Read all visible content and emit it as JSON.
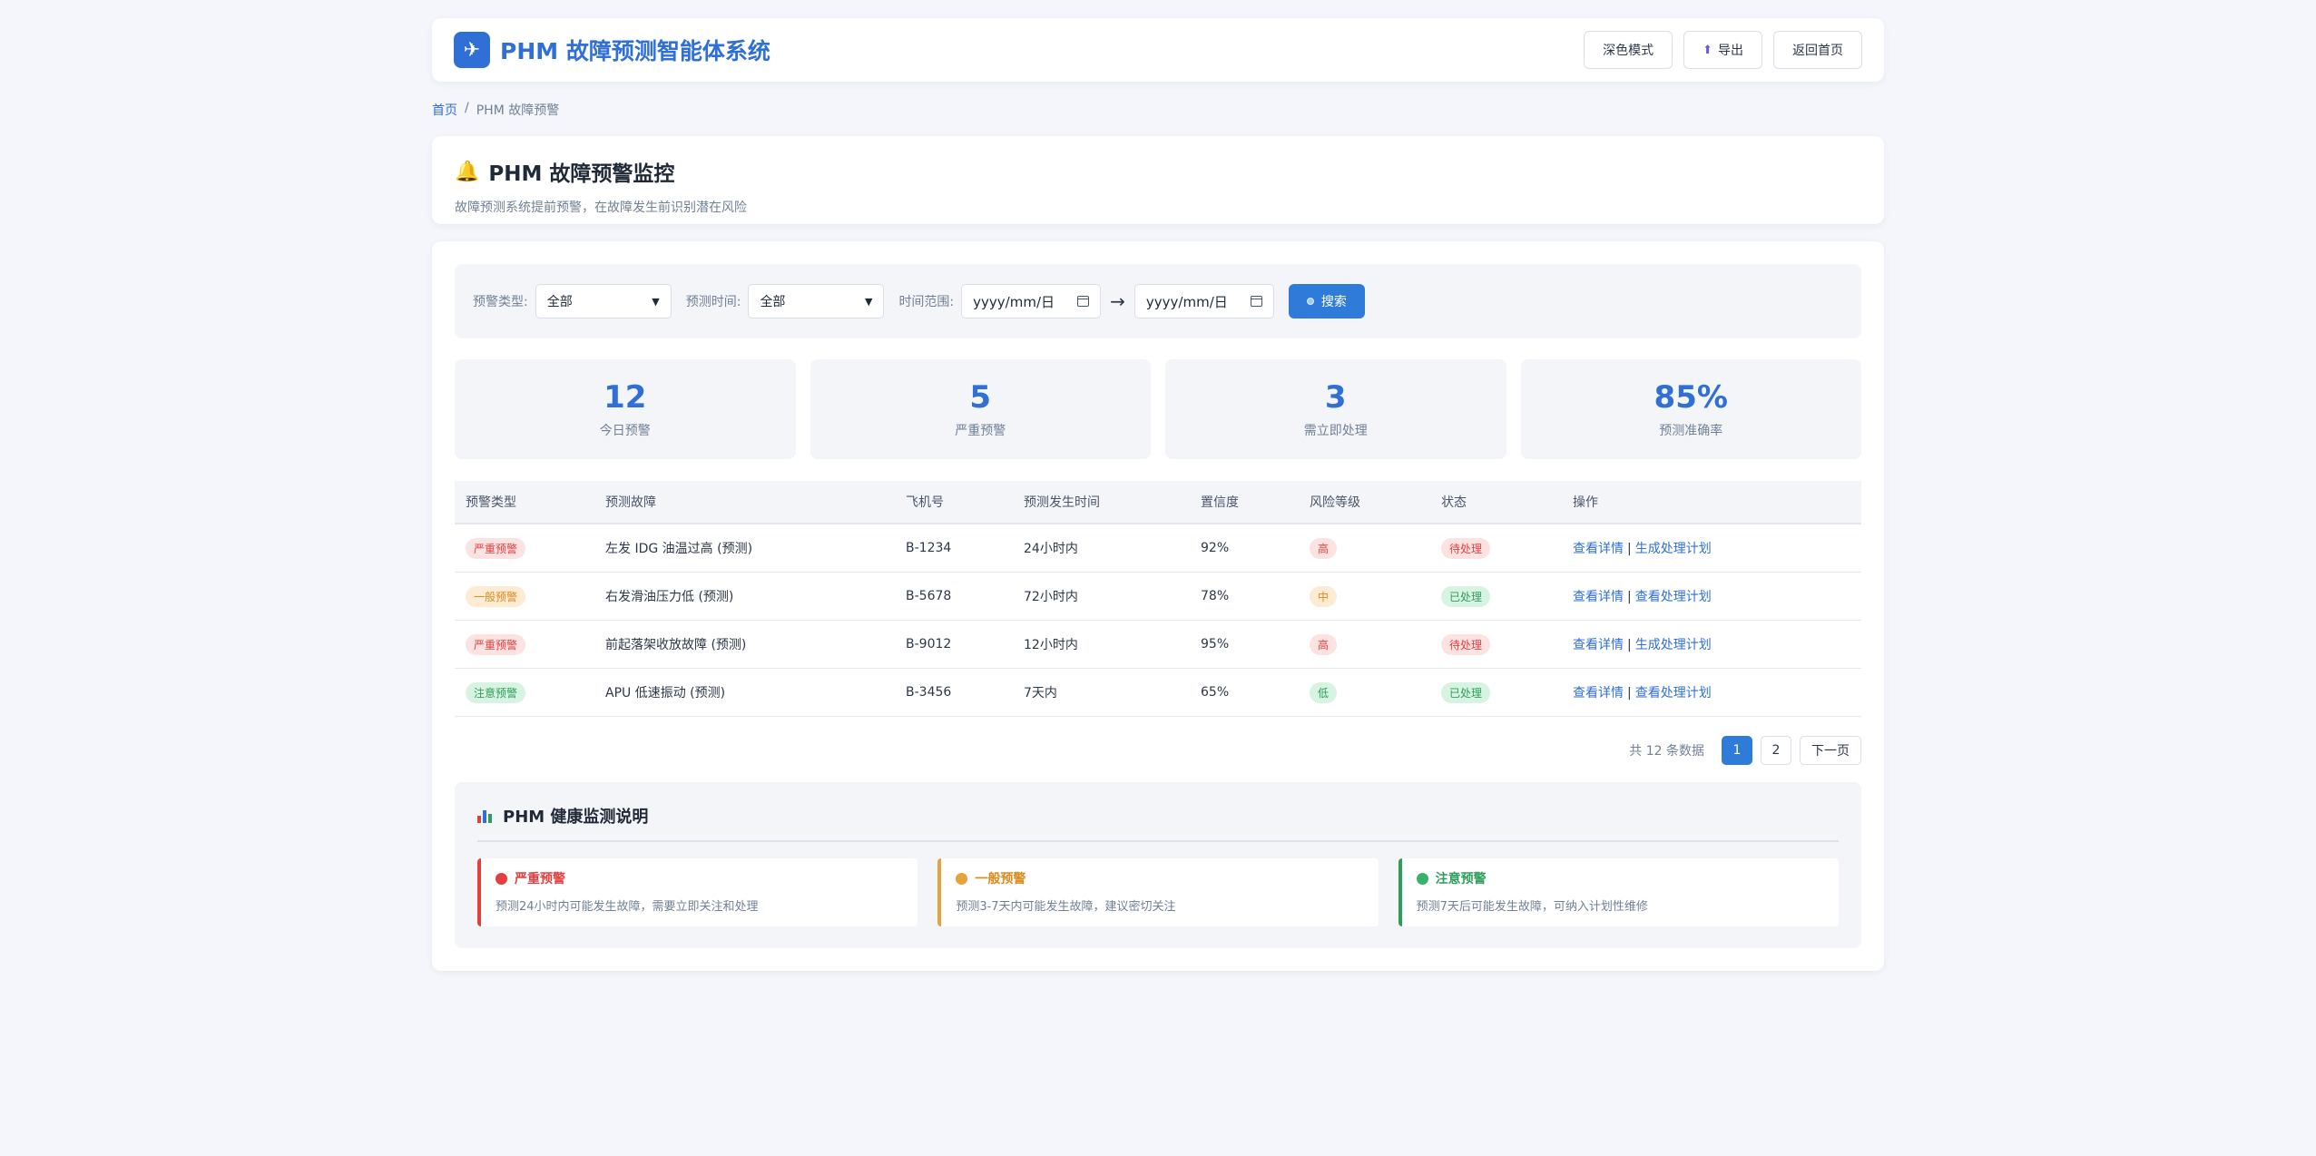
{
  "header": {
    "title": "PHM 故障预测智能体系统",
    "logo_icon": "plane-icon",
    "buttons": {
      "dark_mode": "深色模式",
      "export": "导出",
      "home": "返回首页"
    }
  },
  "breadcrumb": {
    "home": "首页",
    "separator": "/",
    "current": "PHM 故障预警"
  },
  "page": {
    "title": "PHM 故障预警监控",
    "subtitle": "故障预测系统提前预警，在故障发生前识别潜在风险"
  },
  "filters": {
    "type_label": "预警类型:",
    "type_value": "全部",
    "time_label": "预测时间:",
    "time_value": "全部",
    "range_label": "时间范围:",
    "date_start_placeholder": "yyyy/mm/日",
    "date_end_placeholder": "yyyy/mm/日",
    "range_arrow": "→",
    "search_label": "搜索"
  },
  "stats": [
    {
      "value": "12",
      "label": "今日预警"
    },
    {
      "value": "5",
      "label": "严重预警"
    },
    {
      "value": "3",
      "label": "需立即处理"
    },
    {
      "value": "85%",
      "label": "预测准确率"
    }
  ],
  "table": {
    "headers": [
      "预警类型",
      "预测故障",
      "飞机号",
      "预测发生时间",
      "置信度",
      "风险等级",
      "状态",
      "操作"
    ],
    "rows": [
      {
        "type": "严重预警",
        "type_color": "red",
        "fault": "左发 IDG 油温过高 (预测)",
        "aircraft": "B-1234",
        "time": "24小时内",
        "confidence": "92%",
        "risk": "高",
        "risk_color": "red",
        "status": "待处理",
        "status_color": "red",
        "action1": "查看详情",
        "action2": "生成处理计划"
      },
      {
        "type": "一般预警",
        "type_color": "orange",
        "fault": "右发滑油压力低 (预测)",
        "aircraft": "B-5678",
        "time": "72小时内",
        "confidence": "78%",
        "risk": "中",
        "risk_color": "orange",
        "status": "已处理",
        "status_color": "green",
        "action1": "查看详情",
        "action2": "查看处理计划"
      },
      {
        "type": "严重预警",
        "type_color": "red",
        "fault": "前起落架收放故障 (预测)",
        "aircraft": "B-9012",
        "time": "12小时内",
        "confidence": "95%",
        "risk": "高",
        "risk_color": "red",
        "status": "待处理",
        "status_color": "red",
        "action1": "查看详情",
        "action2": "生成处理计划"
      },
      {
        "type": "注意预警",
        "type_color": "green",
        "fault": "APU 低速振动 (预测)",
        "aircraft": "B-3456",
        "time": "7天内",
        "confidence": "65%",
        "risk": "低",
        "risk_color": "green",
        "status": "已处理",
        "status_color": "green",
        "action1": "查看详情",
        "action2": "查看处理计划"
      }
    ],
    "action_separator": "|"
  },
  "pagination": {
    "total": "共 12 条数据",
    "pages": [
      "1",
      "2"
    ],
    "next": "下一页",
    "current": "1"
  },
  "info": {
    "title": "PHM 健康监测说明",
    "items": [
      {
        "name": "严重预警",
        "desc": "预测24小时内可能发生故障，需要立即关注和处理",
        "color": "#e53e3e"
      },
      {
        "name": "一般预警",
        "desc": "预测3-7天内可能发生故障，建议密切关注",
        "color": "#dd8a1c"
      },
      {
        "name": "注意预警",
        "desc": "预测7天后可能发生故障，可纳入计划性维修",
        "color": "#2f9e5a"
      }
    ]
  }
}
